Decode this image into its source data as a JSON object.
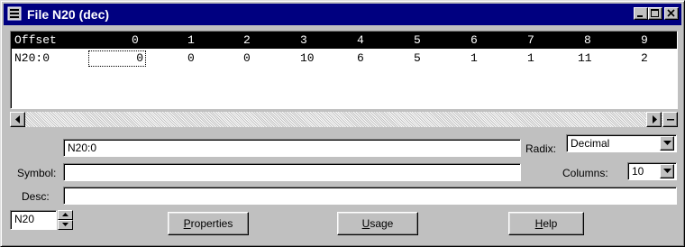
{
  "window": {
    "title": "File N20 (dec)"
  },
  "grid": {
    "header": [
      "Offset",
      "0",
      "1",
      "2",
      "3",
      "4",
      "5",
      "6",
      "7",
      "8",
      "9"
    ],
    "rows": [
      {
        "offset": "N20:0",
        "values": [
          "0",
          "0",
          "0",
          "10",
          "6",
          "5",
          "1",
          "1",
          "11",
          "2"
        ]
      }
    ],
    "selected_cell": "0"
  },
  "address_field": {
    "value": "N20:0"
  },
  "radix": {
    "label": "Radix:",
    "value": "Decimal"
  },
  "symbol": {
    "label": "Symbol:",
    "value": ""
  },
  "columns": {
    "label": "Columns:",
    "value": "10"
  },
  "desc": {
    "label": "Desc:",
    "value": ""
  },
  "file_selector": {
    "value": "N20"
  },
  "buttons": {
    "properties": {
      "accel": "P",
      "rest": "roperties"
    },
    "usage": {
      "accel": "U",
      "rest": "sage"
    },
    "help": {
      "accel": "H",
      "rest": "elp"
    }
  }
}
